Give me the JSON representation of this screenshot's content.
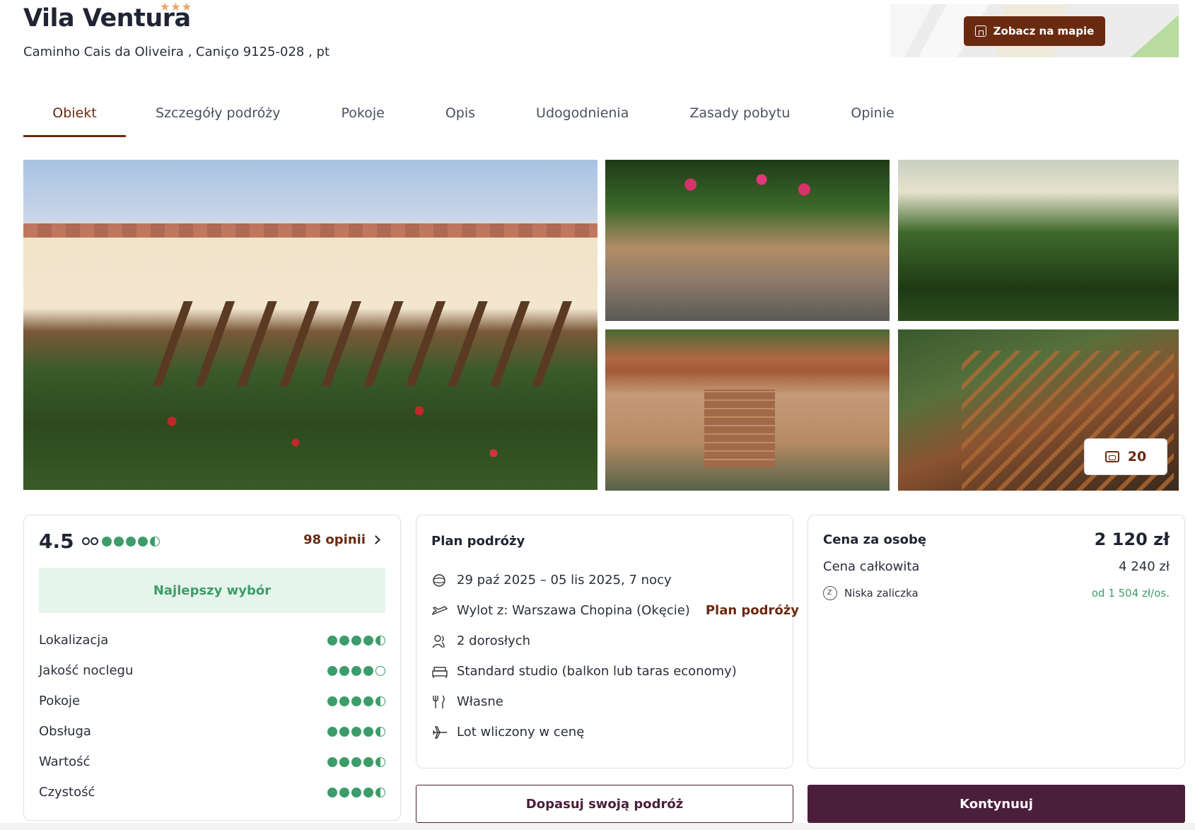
{
  "hotel": {
    "name": "Vila Ventura",
    "stars": "★★★",
    "address": "Caminho Cais da Oliveira , Caniço 9125-028 , pt",
    "map_button": "Zobacz na mapie"
  },
  "tabs": [
    {
      "label": "Obiekt",
      "active": true
    },
    {
      "label": "Szczegóły podróży"
    },
    {
      "label": "Pokoje"
    },
    {
      "label": "Opis"
    },
    {
      "label": "Udogodnienia"
    },
    {
      "label": "Zasady pobytu"
    },
    {
      "label": "Opinie"
    }
  ],
  "gallery": {
    "photo_count": "20"
  },
  "rating": {
    "score": "4.5",
    "reviews_link": "98 opinii",
    "badge": "Najlepszy wybór",
    "overall_dots": 4.5,
    "categories": [
      {
        "label": "Lokalizacja",
        "value": 4.5
      },
      {
        "label": "Jakość noclegu",
        "value": 4
      },
      {
        "label": "Pokoje",
        "value": 4.5
      },
      {
        "label": "Obsługa",
        "value": 4.5
      },
      {
        "label": "Wartość",
        "value": 4.5
      },
      {
        "label": "Czystość",
        "value": 4.5
      }
    ]
  },
  "plan": {
    "title": "Plan podróży",
    "dates": "29 paź 2025 – 05 lis 2025, 7 nocy",
    "departure": "Wylot z: Warszawa Chopina (Okęcie)",
    "departure_link": "Plan podróży",
    "guests": "2 dorosłych",
    "room": "Standard studio (balkon lub taras economy)",
    "board": "Własne",
    "flight": "Lot wliczony w cenę"
  },
  "price": {
    "per_person_label": "Cena za osobę",
    "per_person_value": "2 120 zł",
    "total_label": "Cena całkowita",
    "total_value": "4 240 zł",
    "deposit_label": "Niska zaliczka",
    "deposit_value": "od 1 504 zł/os."
  },
  "actions": {
    "customize": "Dopasuj swoją podróż",
    "continue": "Kontynuuj"
  },
  "colors": {
    "brand": "#6a2a10",
    "primary_button": "#4b1e3b",
    "rating_green": "#3d9c6a",
    "star": "#f0a35e"
  }
}
